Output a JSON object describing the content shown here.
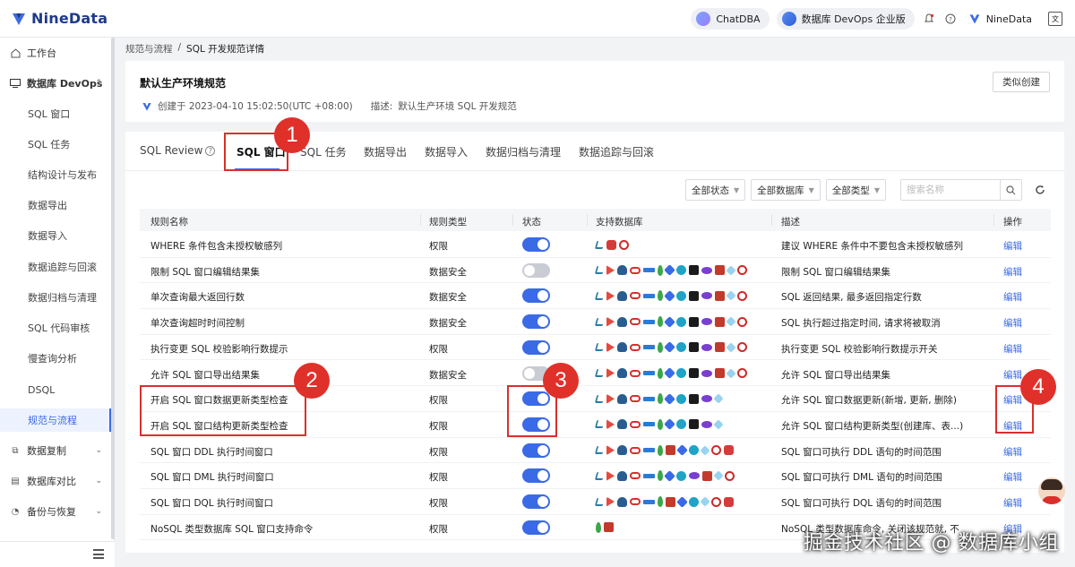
{
  "brand": {
    "name": "NineData"
  },
  "header": {
    "chatdba": "ChatDBA",
    "devops_edition": "数据库 DevOps 企业版",
    "user": "NineData"
  },
  "sidebar": {
    "workbench": "工作台",
    "devops_group": "数据库 DevOps",
    "sub_items": [
      "SQL 窗口",
      "SQL 任务",
      "结构设计与发布",
      "数据导出",
      "数据导入",
      "数据追踪与回滚",
      "数据归档与清理",
      "SQL 代码审核",
      "慢查询分析",
      "DSQL",
      "规范与流程"
    ],
    "active_sub": "规范与流程",
    "groups_bottom": [
      "数据复制",
      "数据库对比",
      "备份与恢复"
    ]
  },
  "breadcrumb": {
    "parent": "规范与流程",
    "separator": "/",
    "current": "SQL 开发规范详情"
  },
  "spec": {
    "title": "默认生产环境规范",
    "created": "创建于 2023-04-10 15:02:50(UTC +08:00)",
    "desc_label": "描述:",
    "desc": "默认生产环境 SQL 开发规范",
    "copy_button": "类似创建"
  },
  "tabs": [
    "SQL Review",
    "SQL 窗口",
    "SQL 任务",
    "数据导出",
    "数据导入",
    "数据归档与清理",
    "数据追踪与回滚"
  ],
  "active_tab": "SQL 窗口",
  "filters": {
    "status": "全部状态",
    "db": "全部数据库",
    "type": "全部类型",
    "search_placeholder": "搜索名称"
  },
  "table": {
    "headers": [
      "规则名称",
      "规则类型",
      "状态",
      "支持数据库",
      "描述",
      "操作"
    ],
    "rows": [
      {
        "name": "WHERE 条件包含未授权敏感列",
        "type": "权限",
        "on": true,
        "dbs": [
          "mysql",
          "redfox",
          "ring"
        ],
        "desc": "建议 WHERE 条件中不要包含未授权敏感列",
        "op": "编辑"
      },
      {
        "name": "限制 SQL 窗口编辑结果集",
        "type": "数据安全",
        "on": false,
        "dbs": [
          "mysql",
          "mssql",
          "pg",
          "oracle",
          "bar",
          "mongo",
          "tidb",
          "swirl",
          "black",
          "link",
          "cube",
          "diamond",
          "ring"
        ],
        "desc": "限制 SQL 窗口编辑结果集",
        "op": "编辑"
      },
      {
        "name": "单次查询最大返回行数",
        "type": "数据安全",
        "on": true,
        "dbs": [
          "mysql",
          "mssql",
          "pg",
          "oracle",
          "bar",
          "mongo",
          "tidb",
          "swirl",
          "black",
          "link",
          "cube",
          "diamond",
          "ring"
        ],
        "desc": "SQL 返回结果, 最多返回指定行数",
        "op": "编辑"
      },
      {
        "name": "单次查询超时时间控制",
        "type": "数据安全",
        "on": true,
        "dbs": [
          "mysql",
          "mssql",
          "pg",
          "oracle",
          "bar",
          "mongo",
          "tidb",
          "swirl",
          "black",
          "link",
          "cube",
          "diamond",
          "ring"
        ],
        "desc": "SQL 执行超过指定时间, 请求将被取消",
        "op": "编辑"
      },
      {
        "name": "执行变更 SQL 校验影响行数提示",
        "type": "权限",
        "on": true,
        "dbs": [
          "mysql",
          "mssql",
          "pg",
          "oracle",
          "bar",
          "mongo",
          "tidb",
          "swirl",
          "black",
          "link",
          "cube",
          "diamond",
          "ring"
        ],
        "desc": "执行变更 SQL 校验影响行数提示开关",
        "op": "编辑"
      },
      {
        "name": "允许 SQL 窗口导出结果集",
        "type": "数据安全",
        "on": false,
        "dbs": [
          "mysql",
          "mssql",
          "pg",
          "oracle",
          "bar",
          "mongo",
          "tidb",
          "swirl",
          "black",
          "link",
          "cube",
          "diamond",
          "ring"
        ],
        "desc": "允许 SQL 窗口导出结果集",
        "op": "编辑"
      },
      {
        "name": "开启 SQL 窗口数据更新类型检查",
        "type": "权限",
        "on": true,
        "dbs": [
          "mysql",
          "mssql",
          "pg",
          "oracle",
          "bar",
          "mongo",
          "tidb",
          "swirl",
          "black",
          "link",
          "diamond"
        ],
        "desc": "允许 SQL 窗口数据更新(新增, 更新, 删除)",
        "op": "编辑"
      },
      {
        "name": "开启 SQL 窗口结构更新类型检查",
        "type": "权限",
        "on": true,
        "dbs": [
          "mysql",
          "mssql",
          "pg",
          "oracle",
          "bar",
          "mongo",
          "tidb",
          "swirl",
          "black",
          "link",
          "diamond"
        ],
        "desc": "允许 SQL 窗口结构更新类型(创建库、表...)",
        "op": "编辑"
      },
      {
        "name": "SQL 窗口 DDL 执行时间窗口",
        "type": "权限",
        "on": true,
        "dbs": [
          "mysql",
          "mssql",
          "pg",
          "oracle",
          "bar",
          "mongo",
          "cube",
          "tidb",
          "swirl",
          "diamond",
          "ring",
          "redfox"
        ],
        "desc": "SQL 窗口可执行 DDL 语句的时间范围",
        "op": "编辑"
      },
      {
        "name": "SQL 窗口 DML 执行时间窗口",
        "type": "权限",
        "on": true,
        "dbs": [
          "mysql",
          "mssql",
          "pg",
          "oracle",
          "bar",
          "mongo",
          "tidb",
          "swirl",
          "link",
          "cube",
          "diamond",
          "ring"
        ],
        "desc": "SQL 窗口可执行 DML 语句的时间范围",
        "op": "编辑"
      },
      {
        "name": "SQL 窗口 DQL 执行时间窗口",
        "type": "权限",
        "on": true,
        "dbs": [
          "mysql",
          "mssql",
          "pg",
          "oracle",
          "bar",
          "mongo",
          "cube",
          "tidb",
          "swirl",
          "diamond",
          "ring",
          "redfox"
        ],
        "desc": "SQL 窗口可执行 DQL 语句的时间范围",
        "op": "编辑"
      },
      {
        "name": "NoSQL 类型数据库 SQL 窗口支持命令",
        "type": "权限",
        "on": true,
        "dbs": [
          "mongo",
          "cube"
        ],
        "desc": "NoSQL 类型数据库命令, 关闭该规范就, 不",
        "op": "编辑"
      }
    ]
  },
  "annotations": [
    "1",
    "2",
    "3",
    "4"
  ],
  "watermark": "掘金技术社区 @ 数据库小组"
}
